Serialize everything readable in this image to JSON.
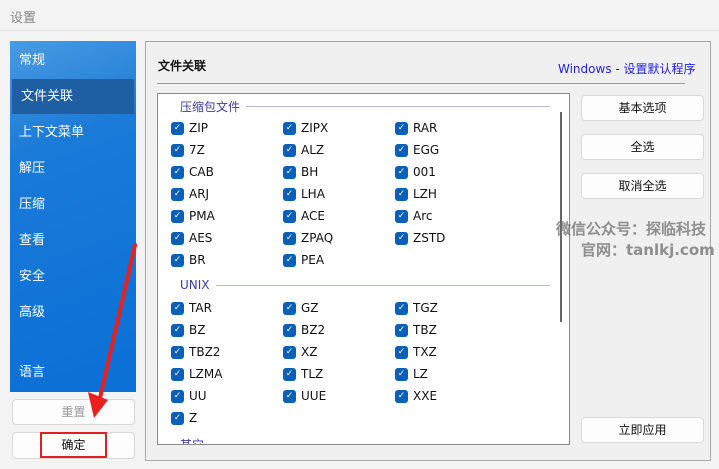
{
  "window": {
    "title": "设置"
  },
  "sidebar": {
    "items": [
      {
        "label": "常规"
      },
      {
        "label": "文件关联",
        "selected": true
      },
      {
        "label": "上下文菜单"
      },
      {
        "label": "解压"
      },
      {
        "label": "压缩"
      },
      {
        "label": "查看"
      },
      {
        "label": "安全"
      },
      {
        "label": "高级"
      },
      {
        "label": "语言"
      }
    ],
    "reset_label": "重置",
    "ok_label": "确定"
  },
  "main": {
    "section_title": "文件关联",
    "link": "Windows - 设置默认程序",
    "groups": [
      {
        "label": "压缩包文件",
        "items": [
          "ZIP",
          "ZIPX",
          "RAR",
          "7Z",
          "ALZ",
          "EGG",
          "CAB",
          "BH",
          "001",
          "ARJ",
          "LHA",
          "LZH",
          "PMA",
          "ACE",
          "Arc",
          "AES",
          "ZPAQ",
          "ZSTD",
          "BR",
          "PEA"
        ]
      },
      {
        "label": "UNIX",
        "items": [
          "TAR",
          "GZ",
          "TGZ",
          "BZ",
          "BZ2",
          "TBZ",
          "TBZ2",
          "XZ",
          "TXZ",
          "LZMA",
          "TLZ",
          "LZ",
          "UU",
          "UUE",
          "XXE",
          "Z"
        ]
      },
      {
        "label": "其它",
        "items": []
      }
    ],
    "buttons": {
      "basic": "基本选项",
      "select_all": "全选",
      "deselect_all": "取消全选",
      "apply": "立即应用"
    }
  },
  "watermark": {
    "line1": "微信公众号：探临科技",
    "line2": "官网：tanlkj.com"
  },
  "colors": {
    "accent": "#0a6fd6",
    "checkbox": "#0a5fb8",
    "link": "#2020ee",
    "highlight": "#e02020"
  }
}
